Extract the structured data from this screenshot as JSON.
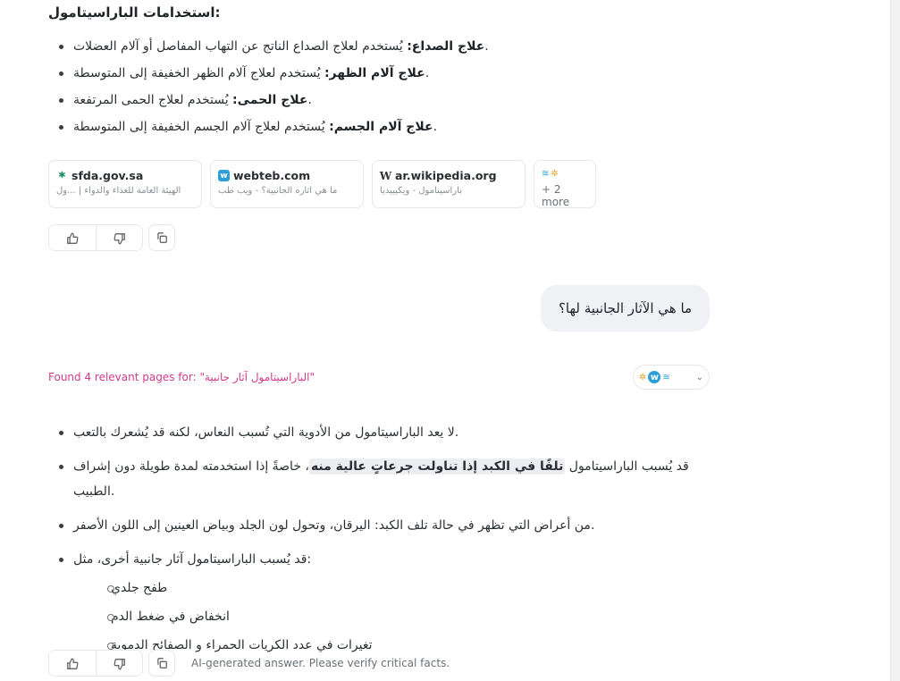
{
  "section1": {
    "heading": "استخدامات الباراسيتامول:",
    "items": [
      {
        "bold": "علاج الصداع:",
        "text": " يُستخدم لعلاج الصداع الناتج عن التهاب المفاصل أو آلام العضلات."
      },
      {
        "bold": "علاج آلام الظهر:",
        "text": " يُستخدم لعلاج آلام الظهر الخفيفة إلى المتوسطة."
      },
      {
        "bold": "علاج الحمى:",
        "text": " يُستخدم لعلاج الحمى المرتفعة."
      },
      {
        "bold": "علاج آلام الجسم:",
        "text": " يُستخدم لعلاج آلام الجسم الخفيفة إلى المتوسطة."
      }
    ]
  },
  "sources": [
    {
      "site": "sfda.gov.sa",
      "sub": "الهيئة العامة للغذاء والدواء | ...ول",
      "icon": "sfda-icon"
    },
    {
      "site": "webteb.com",
      "sub": "ما هي آثاره الجانبية؟ - ويب طب",
      "icon": "webteb-icon"
    },
    {
      "site": "ar.wikipedia.org",
      "sub": "باراسيتامول - ويكيبيديا",
      "icon": "wikipedia-icon"
    }
  ],
  "more_sources": "+ 2 more",
  "user_message": "ما هي الآثار الجانبية لها؟",
  "found_text": "Found 4 relevant pages for: \"الباراسيتامول آثار جانبية\"",
  "section2": {
    "items": [
      {
        "text": "لا يعد الباراسيتامول من الأدوية التي تُسبب النعاس، لكنه قد يُشعرك بالتعب."
      },
      {
        "pre": "قد يُسبب الباراسيتامول ",
        "highlight": "تلفًا في الكبد إذا تناولت جرعاتٍ عالية منه",
        "post": "، خاصةً إذا استخدمته لمدة طويلة دون إشراف الطبيب."
      },
      {
        "text": "من أعراض التي تظهر في حالة تلف الكبد: اليرقان، وتحول لون الجلد وبياض العينين إلى اللون الأصفر."
      },
      {
        "text": "قد يُسبب الباراسيتامول آثار جانبية أخرى، مثل:"
      }
    ],
    "sub_items": [
      "طفح جلدي",
      "انخفاض في ضغط الدم",
      "تغيرات في عدد الكريات الحمراء و الصفائح الدموية"
    ]
  },
  "disclaimer": "AI-generated answer. Please verify critical facts.",
  "colors": {
    "accent_pink": "#d13c8c",
    "bubble": "#f0f1f4",
    "border": "#e6e7ea"
  }
}
